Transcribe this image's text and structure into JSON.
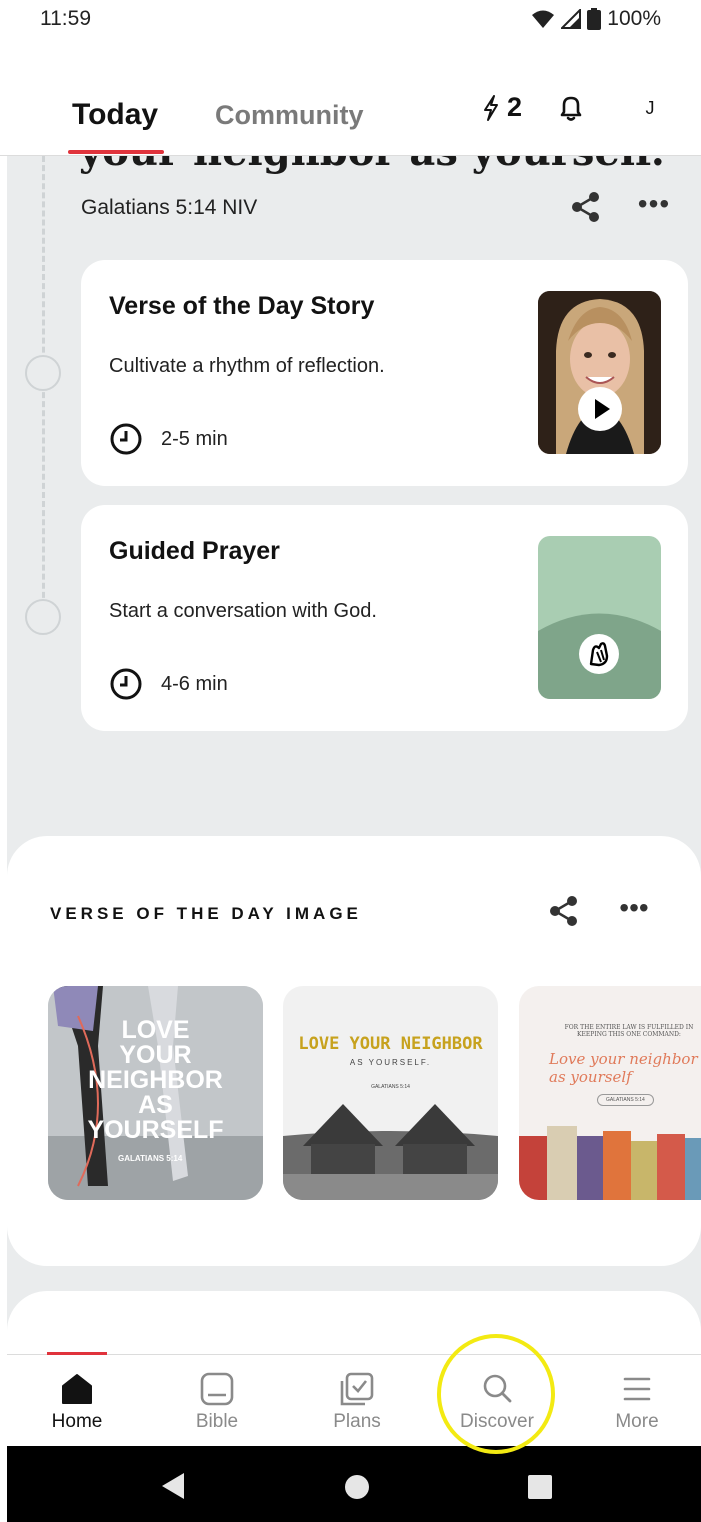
{
  "status": {
    "time": "11:59",
    "battery": "100%"
  },
  "header": {
    "tab_today": "Today",
    "tab_community": "Community",
    "streak_count": "2",
    "avatar_initial": "J"
  },
  "verse": {
    "partial_text": "your neighbor as yourself.",
    "reference": "Galatians 5:14 NIV"
  },
  "cards": [
    {
      "title": "Verse of the Day Story",
      "subtitle": "Cultivate a rhythm of reflection.",
      "duration": "2-5 min"
    },
    {
      "title": "Guided Prayer",
      "subtitle": "Start a conversation with God.",
      "duration": "4-6 min"
    }
  ],
  "votd_image": {
    "section_title": "VERSE OF THE DAY IMAGE",
    "tiles": [
      {
        "lines": [
          "LOVE",
          "YOUR",
          "NEIGHBOR",
          "AS",
          "YOURSELF"
        ],
        "ref": "GALATIANS 5:14"
      },
      {
        "heading": "LOVE YOUR NEIGHBOR",
        "sub": "AS YOURSELF.",
        "ref": "GALATIANS 5:14"
      },
      {
        "top": "FOR THE ENTIRE LAW IS FULFILLED IN KEEPING THIS ONE COMMAND:",
        "script": "Love your neighbor as yourself",
        "ref": "GALATIANS 5:14"
      }
    ]
  },
  "nav": {
    "items": [
      "Home",
      "Bible",
      "Plans",
      "Discover",
      "More"
    ]
  },
  "colors": {
    "accent": "#e0333c",
    "highlight": "#f3ea12",
    "prayer_light": "#a9cdb2",
    "prayer_dark": "#7fa58a"
  }
}
